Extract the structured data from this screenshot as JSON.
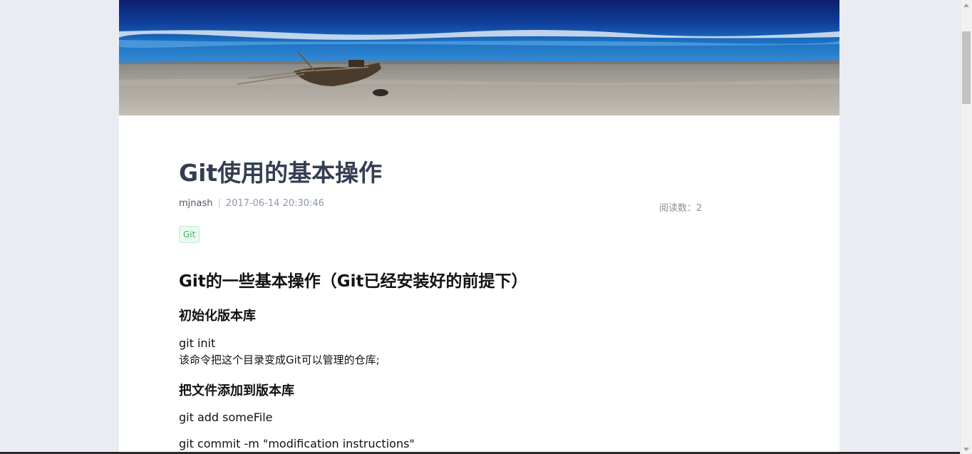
{
  "post": {
    "title": "Git使用的基本操作",
    "author": "mjnash",
    "separator": "|",
    "date": "2017-06-14 20:30:46",
    "read_count": "阅读数：2",
    "tag": "Git"
  },
  "article": {
    "heading": "Git的一些基本操作（Git已经安装好的前提下）",
    "section1": {
      "title": "初始化版本库",
      "command": "git init",
      "description": "该命令把这个目录变成Git可以管理的仓库;"
    },
    "section2": {
      "title": "把文件添加到版本库",
      "command1": "git add someFile",
      "command2": "git commit -m \"modification instructions\""
    }
  },
  "colors": {
    "page_bg": "#e9ecf2",
    "title": "#343e52",
    "tag_green": "#3bb36a",
    "meta_date": "#8c98ad"
  },
  "icons": {
    "banner": "beach-boat-photo"
  }
}
